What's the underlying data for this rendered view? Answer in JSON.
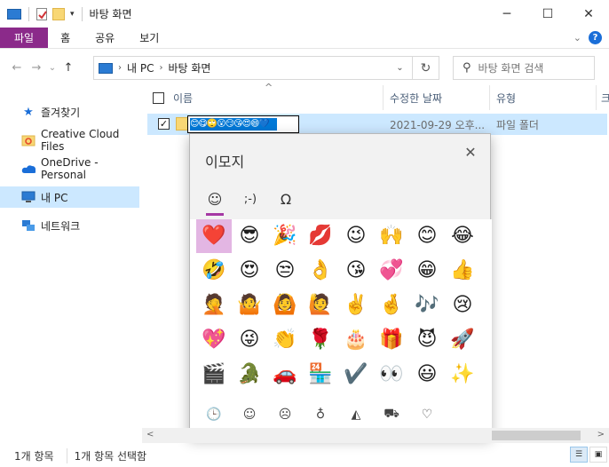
{
  "window": {
    "title": "바탕 화면",
    "controls": {
      "minimize": "─",
      "maximize": "☐",
      "close": "✕"
    }
  },
  "ribbon": {
    "tabs": [
      "파일",
      "홈",
      "공유",
      "보기"
    ],
    "expand": "⌄",
    "help": "?"
  },
  "nav": {
    "back": "←",
    "forward": "→",
    "recent": "⌄",
    "up": "↑",
    "breadcrumb": [
      "내 PC",
      "바탕 화면"
    ],
    "breadcrumb_sep": "›",
    "dropdown": "⌄",
    "refresh": "↻",
    "search_placeholder": "바탕 화면 검색"
  },
  "sidebar": {
    "items": [
      {
        "label": "즐겨찾기",
        "icon": "star-icon",
        "glyph": "★",
        "color": "#1a6ed8"
      },
      {
        "label": "Creative Cloud Files",
        "icon": "creative-cloud-folder-icon",
        "glyph": "▰",
        "color": "#e44b2c"
      },
      {
        "label": "OneDrive - Personal",
        "icon": "onedrive-cloud-icon",
        "glyph": "☁",
        "color": "#1a6ed8"
      },
      {
        "label": "내 PC",
        "icon": "computer-icon",
        "glyph": "▭",
        "color": "#2b7bd3"
      },
      {
        "label": "네트워크",
        "icon": "network-icon",
        "glyph": "▦",
        "color": "#2b7bd3"
      }
    ],
    "selected_index": 3
  },
  "columns": {
    "sort_arrow": "^",
    "name": "이름",
    "date": "수정한 날짜",
    "type": "유형",
    "overflow": "크"
  },
  "file": {
    "checked_mark": "✓",
    "rename_value": "😊😋🙄😮😏😘😍😄💙",
    "date": "2021-09-29 오후...",
    "type": "파일 폴더"
  },
  "emoji_panel": {
    "title": "이모지",
    "close": "✕",
    "tabs": [
      {
        "label": "☺",
        "name": "emoji-tab"
      },
      {
        "label": ";-)",
        "name": "kaomoji-tab"
      },
      {
        "label": "Ω",
        "name": "symbols-tab"
      }
    ],
    "active_tab": 0,
    "emojis": [
      "❤️",
      "😎",
      "🎉",
      "💋",
      "😉",
      "🙌",
      "😊",
      "😂",
      "🤣",
      "😍",
      "😒",
      "👌",
      "😘",
      "💞",
      "😁",
      "👍",
      "🤦",
      "🤷",
      "🙆",
      "🙋",
      "✌️",
      "🤞",
      "🎶",
      "😢",
      "💖",
      "😜",
      "👏",
      "🌹",
      "🎂",
      "🎁",
      "😈",
      "🚀",
      "🎬",
      "🐊",
      "🚗",
      "🏪",
      "✔️",
      "👀",
      "😃",
      "✨"
    ],
    "selected_emoji_index": 0,
    "categories": [
      {
        "glyph": "🕒",
        "name": "recent-category-icon"
      },
      {
        "glyph": "☺",
        "name": "smiley-category-icon"
      },
      {
        "glyph": "☹",
        "name": "people-category-icon"
      },
      {
        "glyph": "♁",
        "name": "celebration-category-icon"
      },
      {
        "glyph": "◭",
        "name": "food-category-icon"
      },
      {
        "glyph": "⛟",
        "name": "travel-category-icon"
      },
      {
        "glyph": "♡",
        "name": "heart-category-icon"
      }
    ],
    "active_category": 0
  },
  "scrollbar": {
    "left": "<",
    "right": ">"
  },
  "status": {
    "count": "1개 항목",
    "selected": "1개 항목 선택함"
  },
  "colors": {
    "accent": "#8b2a8a",
    "selection": "#cce8ff",
    "emoji_highlight": "#e3b6e3",
    "text_highlight": "#0078d7"
  }
}
